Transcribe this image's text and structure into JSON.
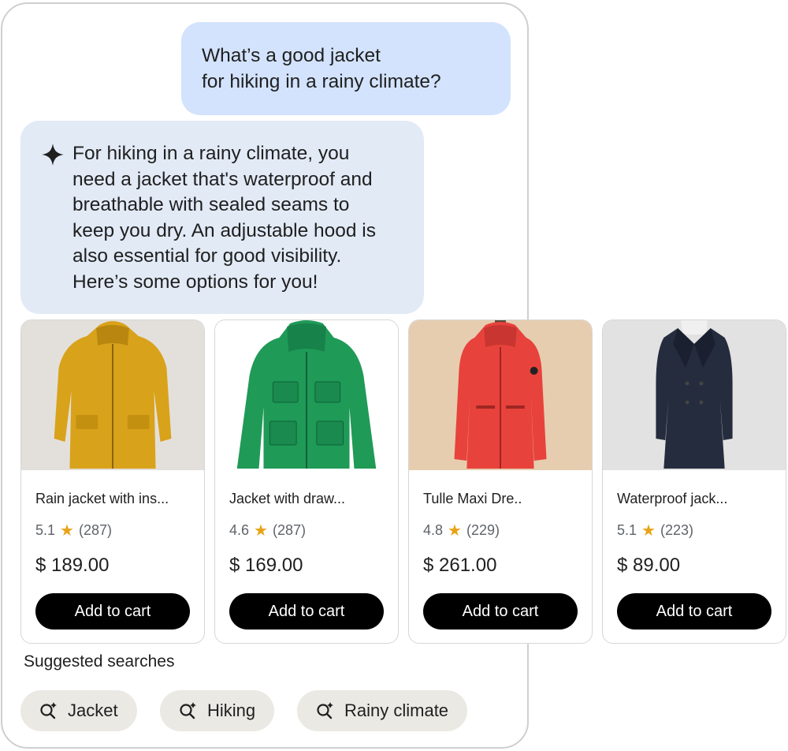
{
  "conversation": {
    "user_message": {
      "line1": "What’s a good jacket",
      "line2": "for hiking in a rainy climate?"
    },
    "ai_message": {
      "icon": "sparkle-icon",
      "line1": "For hiking in a rainy climate, you",
      "line2": "need a jacket that's waterproof and",
      "line3": "breathable with sealed seams to",
      "line4": "keep you dry. An adjustable hood is",
      "line5": "also essential for good visibility.",
      "line6": "Here’s some options for you!"
    }
  },
  "products": [
    {
      "title": "Rain jacket with ins...",
      "rating": "5.1",
      "reviews": "(287)",
      "price": "$ 189.00",
      "button": "Add to cart",
      "color": "#d9a21b"
    },
    {
      "title": "Jacket with draw...",
      "rating": "4.6",
      "reviews": "(287)",
      "price": "$ 169.00",
      "button": "Add to cart",
      "color": "#1f9a57"
    },
    {
      "title": "Tulle Maxi Dre..",
      "rating": "4.8",
      "reviews": "(229)",
      "price": "$ 261.00",
      "button": "Add to cart",
      "color": "#e8423c"
    },
    {
      "title": "Waterproof jack...",
      "rating": "5.1",
      "reviews": "(223)",
      "price": "$ 89.00",
      "button": "Add to cart",
      "color": "#252c3d"
    }
  ],
  "suggested": {
    "title": "Suggested searches",
    "chips": [
      {
        "label": "Jacket",
        "icon": "sparkle-search-icon"
      },
      {
        "label": "Hiking",
        "icon": "sparkle-search-icon"
      },
      {
        "label": "Rainy climate",
        "icon": "sparkle-search-icon"
      }
    ]
  },
  "colors": {
    "user_bubble": "#d3e3fd",
    "ai_bubble": "#e2eaf6",
    "button": "#000000",
    "star": "#e8a317",
    "chip": "#ebe9e4"
  }
}
